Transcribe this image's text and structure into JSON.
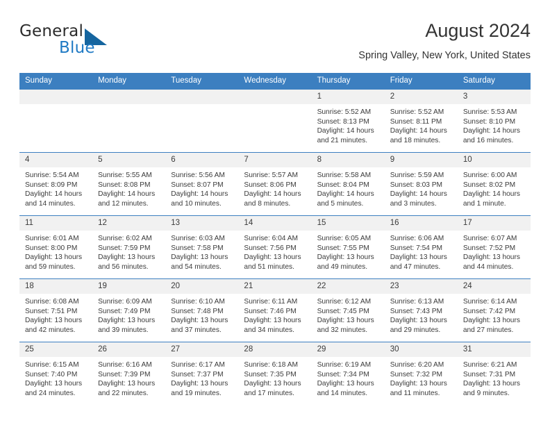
{
  "brand": {
    "name_top": "General",
    "name_bottom": "Blue",
    "accent_color": "#1f7ac4",
    "triangle_color": "#15659f"
  },
  "header": {
    "title": "August 2024",
    "subtitle": "Spring Valley, New York, United States",
    "header_bg": "#3c7fc0",
    "daynum_bg": "#f1f1f1"
  },
  "weekdays": [
    "Sunday",
    "Monday",
    "Tuesday",
    "Wednesday",
    "Thursday",
    "Friday",
    "Saturday"
  ],
  "labels": {
    "sunrise": "Sunrise:",
    "sunset": "Sunset:",
    "daylight": "Daylight:"
  },
  "weeks": [
    [
      {
        "day": "",
        "blank": true,
        "line1": "",
        "line2": "",
        "line3": "",
        "line4": ""
      },
      {
        "day": "",
        "blank": true,
        "line1": "",
        "line2": "",
        "line3": "",
        "line4": ""
      },
      {
        "day": "",
        "blank": true,
        "line1": "",
        "line2": "",
        "line3": "",
        "line4": ""
      },
      {
        "day": "",
        "blank": true,
        "line1": "",
        "line2": "",
        "line3": "",
        "line4": ""
      },
      {
        "day": "1",
        "blank": false,
        "line1": "Sunrise: 5:52 AM",
        "line2": "Sunset: 8:13 PM",
        "line3": "Daylight: 14 hours",
        "line4": "and 21 minutes."
      },
      {
        "day": "2",
        "blank": false,
        "line1": "Sunrise: 5:52 AM",
        "line2": "Sunset: 8:11 PM",
        "line3": "Daylight: 14 hours",
        "line4": "and 18 minutes."
      },
      {
        "day": "3",
        "blank": false,
        "line1": "Sunrise: 5:53 AM",
        "line2": "Sunset: 8:10 PM",
        "line3": "Daylight: 14 hours",
        "line4": "and 16 minutes."
      }
    ],
    [
      {
        "day": "4",
        "blank": false,
        "line1": "Sunrise: 5:54 AM",
        "line2": "Sunset: 8:09 PM",
        "line3": "Daylight: 14 hours",
        "line4": "and 14 minutes."
      },
      {
        "day": "5",
        "blank": false,
        "line1": "Sunrise: 5:55 AM",
        "line2": "Sunset: 8:08 PM",
        "line3": "Daylight: 14 hours",
        "line4": "and 12 minutes."
      },
      {
        "day": "6",
        "blank": false,
        "line1": "Sunrise: 5:56 AM",
        "line2": "Sunset: 8:07 PM",
        "line3": "Daylight: 14 hours",
        "line4": "and 10 minutes."
      },
      {
        "day": "7",
        "blank": false,
        "line1": "Sunrise: 5:57 AM",
        "line2": "Sunset: 8:06 PM",
        "line3": "Daylight: 14 hours",
        "line4": "and 8 minutes."
      },
      {
        "day": "8",
        "blank": false,
        "line1": "Sunrise: 5:58 AM",
        "line2": "Sunset: 8:04 PM",
        "line3": "Daylight: 14 hours",
        "line4": "and 5 minutes."
      },
      {
        "day": "9",
        "blank": false,
        "line1": "Sunrise: 5:59 AM",
        "line2": "Sunset: 8:03 PM",
        "line3": "Daylight: 14 hours",
        "line4": "and 3 minutes."
      },
      {
        "day": "10",
        "blank": false,
        "line1": "Sunrise: 6:00 AM",
        "line2": "Sunset: 8:02 PM",
        "line3": "Daylight: 14 hours",
        "line4": "and 1 minute."
      }
    ],
    [
      {
        "day": "11",
        "blank": false,
        "line1": "Sunrise: 6:01 AM",
        "line2": "Sunset: 8:00 PM",
        "line3": "Daylight: 13 hours",
        "line4": "and 59 minutes."
      },
      {
        "day": "12",
        "blank": false,
        "line1": "Sunrise: 6:02 AM",
        "line2": "Sunset: 7:59 PM",
        "line3": "Daylight: 13 hours",
        "line4": "and 56 minutes."
      },
      {
        "day": "13",
        "blank": false,
        "line1": "Sunrise: 6:03 AM",
        "line2": "Sunset: 7:58 PM",
        "line3": "Daylight: 13 hours",
        "line4": "and 54 minutes."
      },
      {
        "day": "14",
        "blank": false,
        "line1": "Sunrise: 6:04 AM",
        "line2": "Sunset: 7:56 PM",
        "line3": "Daylight: 13 hours",
        "line4": "and 51 minutes."
      },
      {
        "day": "15",
        "blank": false,
        "line1": "Sunrise: 6:05 AM",
        "line2": "Sunset: 7:55 PM",
        "line3": "Daylight: 13 hours",
        "line4": "and 49 minutes."
      },
      {
        "day": "16",
        "blank": false,
        "line1": "Sunrise: 6:06 AM",
        "line2": "Sunset: 7:54 PM",
        "line3": "Daylight: 13 hours",
        "line4": "and 47 minutes."
      },
      {
        "day": "17",
        "blank": false,
        "line1": "Sunrise: 6:07 AM",
        "line2": "Sunset: 7:52 PM",
        "line3": "Daylight: 13 hours",
        "line4": "and 44 minutes."
      }
    ],
    [
      {
        "day": "18",
        "blank": false,
        "line1": "Sunrise: 6:08 AM",
        "line2": "Sunset: 7:51 PM",
        "line3": "Daylight: 13 hours",
        "line4": "and 42 minutes."
      },
      {
        "day": "19",
        "blank": false,
        "line1": "Sunrise: 6:09 AM",
        "line2": "Sunset: 7:49 PM",
        "line3": "Daylight: 13 hours",
        "line4": "and 39 minutes."
      },
      {
        "day": "20",
        "blank": false,
        "line1": "Sunrise: 6:10 AM",
        "line2": "Sunset: 7:48 PM",
        "line3": "Daylight: 13 hours",
        "line4": "and 37 minutes."
      },
      {
        "day": "21",
        "blank": false,
        "line1": "Sunrise: 6:11 AM",
        "line2": "Sunset: 7:46 PM",
        "line3": "Daylight: 13 hours",
        "line4": "and 34 minutes."
      },
      {
        "day": "22",
        "blank": false,
        "line1": "Sunrise: 6:12 AM",
        "line2": "Sunset: 7:45 PM",
        "line3": "Daylight: 13 hours",
        "line4": "and 32 minutes."
      },
      {
        "day": "23",
        "blank": false,
        "line1": "Sunrise: 6:13 AM",
        "line2": "Sunset: 7:43 PM",
        "line3": "Daylight: 13 hours",
        "line4": "and 29 minutes."
      },
      {
        "day": "24",
        "blank": false,
        "line1": "Sunrise: 6:14 AM",
        "line2": "Sunset: 7:42 PM",
        "line3": "Daylight: 13 hours",
        "line4": "and 27 minutes."
      }
    ],
    [
      {
        "day": "25",
        "blank": false,
        "line1": "Sunrise: 6:15 AM",
        "line2": "Sunset: 7:40 PM",
        "line3": "Daylight: 13 hours",
        "line4": "and 24 minutes."
      },
      {
        "day": "26",
        "blank": false,
        "line1": "Sunrise: 6:16 AM",
        "line2": "Sunset: 7:39 PM",
        "line3": "Daylight: 13 hours",
        "line4": "and 22 minutes."
      },
      {
        "day": "27",
        "blank": false,
        "line1": "Sunrise: 6:17 AM",
        "line2": "Sunset: 7:37 PM",
        "line3": "Daylight: 13 hours",
        "line4": "and 19 minutes."
      },
      {
        "day": "28",
        "blank": false,
        "line1": "Sunrise: 6:18 AM",
        "line2": "Sunset: 7:35 PM",
        "line3": "Daylight: 13 hours",
        "line4": "and 17 minutes."
      },
      {
        "day": "29",
        "blank": false,
        "line1": "Sunrise: 6:19 AM",
        "line2": "Sunset: 7:34 PM",
        "line3": "Daylight: 13 hours",
        "line4": "and 14 minutes."
      },
      {
        "day": "30",
        "blank": false,
        "line1": "Sunrise: 6:20 AM",
        "line2": "Sunset: 7:32 PM",
        "line3": "Daylight: 13 hours",
        "line4": "and 11 minutes."
      },
      {
        "day": "31",
        "blank": false,
        "line1": "Sunrise: 6:21 AM",
        "line2": "Sunset: 7:31 PM",
        "line3": "Daylight: 13 hours",
        "line4": "and 9 minutes."
      }
    ]
  ]
}
